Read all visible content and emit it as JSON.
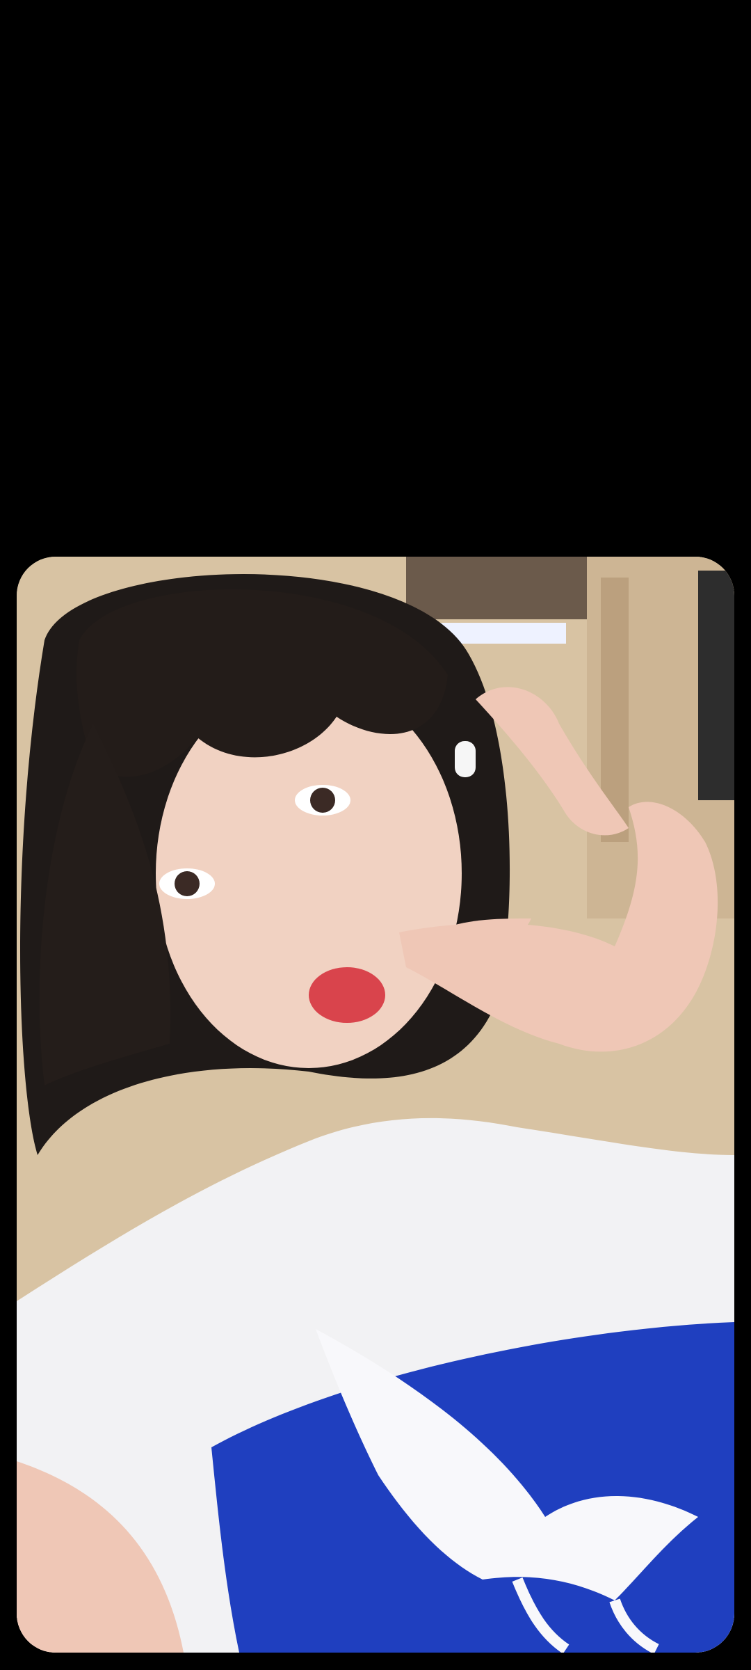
{
  "screen": {
    "background": "#000000"
  },
  "photo": {
    "subject": "selfie-photo",
    "colors": {
      "interior": "#d8c3a3",
      "hair": "#1f1a18",
      "skin": "#f1d2c2",
      "lips": "#d9444c",
      "shirt_white": "#f2f2f4",
      "shirt_blue": "#1f3fbf",
      "eagle": "#f8f8fb"
    }
  }
}
